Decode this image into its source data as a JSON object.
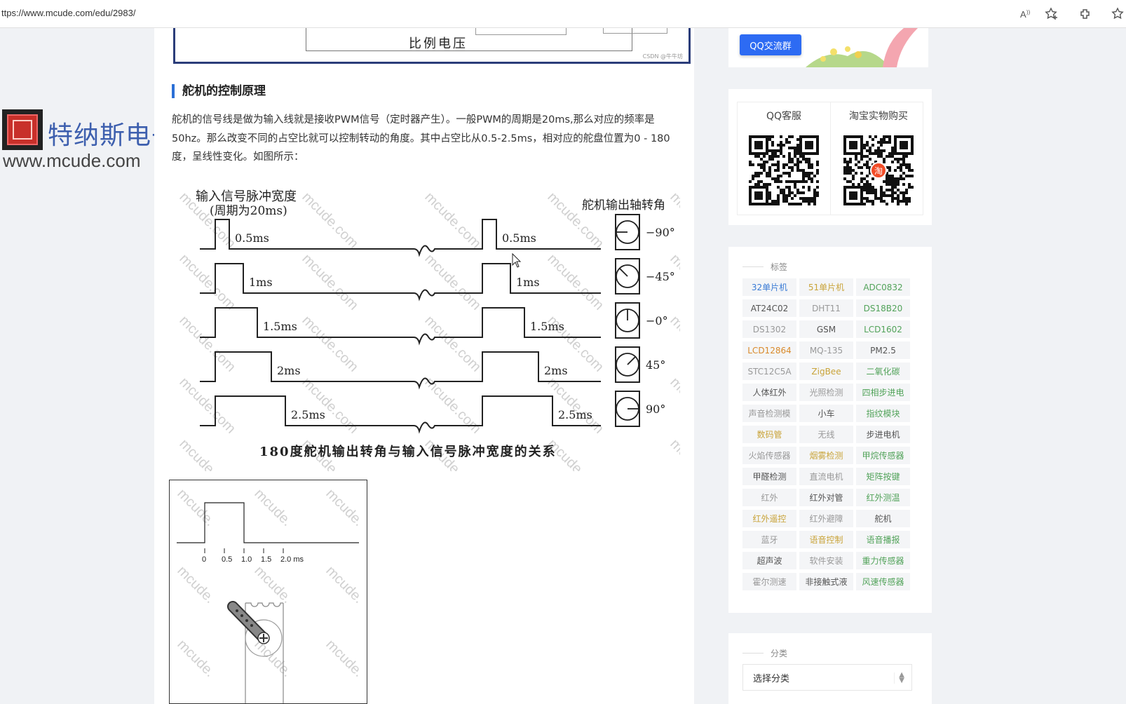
{
  "browser": {
    "url": "ttps://www.mcude.com/edu/2983/"
  },
  "logo": {
    "text": "特纳斯电子",
    "url": "www.mcude.com"
  },
  "article": {
    "top_figure_caption": "比例电压",
    "top_figure_credit": "CSDN @牛牛坊",
    "heading": "舵机的控制原理",
    "paragraph": "舵机的信号线是做为输入线就是接收PWM信号（定时器产生）。一般PWM的周期是20ms,那么对应的频率是50hz。那么改变不同的占空比就可以控制转动的角度。其中占空比从0.5-2.5ms，相对应的舵盘位置为0 - 180度，呈线性变化。如图所示：",
    "figure1": {
      "left_title_1": "输入信号脉冲宽度",
      "left_title_2": "(周期为20ms)",
      "right_title": "舵机输出轴转角",
      "caption": "180度舵机输出转角与输入信号脉冲宽度的关系",
      "watermark": "mcude.com",
      "rows": [
        {
          "label": "0.5ms",
          "angle": "−90°",
          "width_ms": 0.5
        },
        {
          "label": "1ms",
          "angle": "−45°",
          "width_ms": 1.0
        },
        {
          "label": "1.5ms",
          "angle": "−0°",
          "width_ms": 1.5
        },
        {
          "label": "2ms",
          "angle": "45°",
          "width_ms": 2.0
        },
        {
          "label": "2.5ms",
          "angle": "90°",
          "width_ms": 2.5
        }
      ]
    },
    "figure2": {
      "ticks": [
        "0",
        "0.5",
        "1.0",
        "1.5",
        "2.0 ms"
      ],
      "watermark": "mcude."
    }
  },
  "sidebar": {
    "qq_group_button": "QQ交流群",
    "qq_service_title": "QQ客服",
    "taobao_title": "淘宝实物购买",
    "taobao_badge": "淘",
    "tags_title": "标签",
    "tags": [
      {
        "label": "32单片机",
        "color": "#3a7bd5"
      },
      {
        "label": "51单片机",
        "color": "#c9a43a"
      },
      {
        "label": "ADC0832",
        "color": "#52a35a"
      },
      {
        "label": "AT24C02",
        "color": "#555555"
      },
      {
        "label": "DHT11",
        "color": "#999999"
      },
      {
        "label": "DS18B20",
        "color": "#52a35a"
      },
      {
        "label": "DS1302",
        "color": "#999999"
      },
      {
        "label": "GSM",
        "color": "#555555"
      },
      {
        "label": "LCD1602",
        "color": "#52a35a"
      },
      {
        "label": "LCD12864",
        "color": "#d98a2b"
      },
      {
        "label": "MQ-135",
        "color": "#999999"
      },
      {
        "label": "PM2.5",
        "color": "#555555"
      },
      {
        "label": "STC12C5A",
        "color": "#999999"
      },
      {
        "label": "ZigBee",
        "color": "#c9a43a"
      },
      {
        "label": "二氧化碳",
        "color": "#52a35a"
      },
      {
        "label": "人体红外",
        "color": "#555555"
      },
      {
        "label": "光照检测",
        "color": "#999999"
      },
      {
        "label": "四相步进电",
        "color": "#52a35a"
      },
      {
        "label": "声音检测模",
        "color": "#999999"
      },
      {
        "label": "小车",
        "color": "#555555"
      },
      {
        "label": "指纹模块",
        "color": "#52a35a"
      },
      {
        "label": "数码管",
        "color": "#c9a43a"
      },
      {
        "label": "无线",
        "color": "#999999"
      },
      {
        "label": "步进电机",
        "color": "#555555"
      },
      {
        "label": "火焰传感器",
        "color": "#999999"
      },
      {
        "label": "烟雾检测",
        "color": "#c9a43a"
      },
      {
        "label": "甲烷传感器",
        "color": "#52a35a"
      },
      {
        "label": "甲醛检测",
        "color": "#555555"
      },
      {
        "label": "直流电机",
        "color": "#999999"
      },
      {
        "label": "矩阵按键",
        "color": "#52a35a"
      },
      {
        "label": "红外",
        "color": "#999999"
      },
      {
        "label": "红外对管",
        "color": "#555555"
      },
      {
        "label": "红外测温",
        "color": "#52a35a"
      },
      {
        "label": "红外遥控",
        "color": "#c9a43a"
      },
      {
        "label": "红外避障",
        "color": "#999999"
      },
      {
        "label": "舵机",
        "color": "#555555"
      },
      {
        "label": "蓝牙",
        "color": "#999999"
      },
      {
        "label": "语音控制",
        "color": "#c9a43a"
      },
      {
        "label": "语音播报",
        "color": "#52a35a"
      },
      {
        "label": "超声波",
        "color": "#555555"
      },
      {
        "label": "软件安装",
        "color": "#999999"
      },
      {
        "label": "重力传感器",
        "color": "#52a35a"
      },
      {
        "label": "霍尔测速",
        "color": "#999999"
      },
      {
        "label": "非接触式液",
        "color": "#555555"
      },
      {
        "label": "风速传感器",
        "color": "#52a35a"
      }
    ],
    "category_title": "分类",
    "category_select": "选择分类"
  }
}
